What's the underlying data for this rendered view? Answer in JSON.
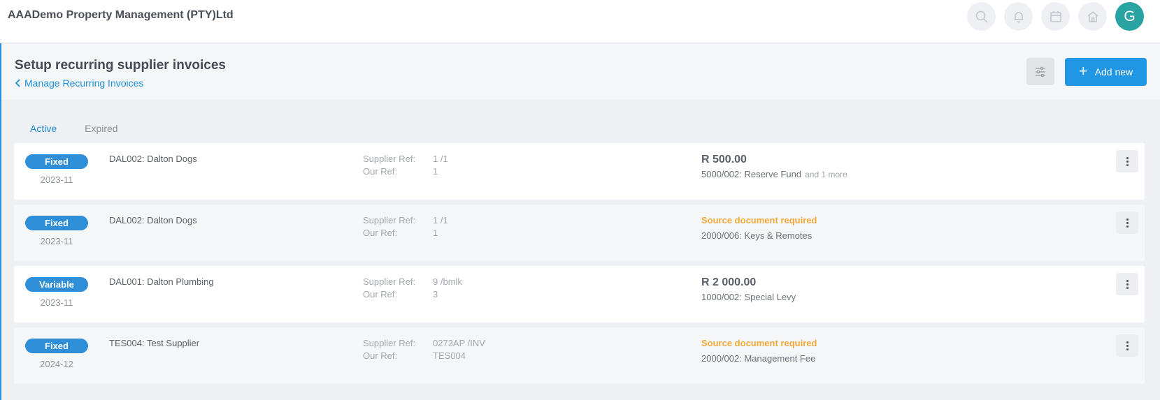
{
  "header": {
    "company": "AAADemo Property Management (PTY)Ltd",
    "avatar_letter": "G",
    "icons": [
      "search-icon",
      "bell-icon",
      "calendar-icon",
      "home-icon"
    ]
  },
  "page": {
    "title": "Setup recurring supplier invoices",
    "back_link": "Manage Recurring Invoices",
    "add_label": "Add new",
    "filter_icon": "sliders-icon"
  },
  "tabs": [
    {
      "label": "Active",
      "active": true
    },
    {
      "label": "Expired",
      "active": false
    }
  ],
  "labels": {
    "supplier_ref": "Supplier Ref:",
    "our_ref": "Our Ref:"
  },
  "invoices": [
    {
      "type": "Fixed",
      "period": "2023-11",
      "supplier": "DAL002: Dalton Dogs",
      "supplier_ref": "1 /1",
      "our_ref": "1",
      "amount": "R 500.00",
      "account": "5000/002: Reserve Fund",
      "more": "and 1 more"
    },
    {
      "type": "Fixed",
      "period": "2023-11",
      "supplier": "DAL002: Dalton Dogs",
      "supplier_ref": "1 /1",
      "our_ref": "1",
      "warning": "Source document required",
      "account": "2000/006: Keys & Remotes"
    },
    {
      "type": "Variable",
      "period": "2023-11",
      "supplier": "DAL001: Dalton Plumbing",
      "supplier_ref": "9 /bmlk",
      "our_ref": "3",
      "amount": "R 2 000.00",
      "account": "1000/002: Special Levy"
    },
    {
      "type": "Fixed",
      "period": "2024-12",
      "supplier": "TES004: Test Supplier",
      "supplier_ref": "0273AP /INV",
      "our_ref": "TES004",
      "warning": "Source document required",
      "account": "2000/002: Management Fee"
    }
  ],
  "colors": {
    "accent": "#2196e4",
    "badge": "#2e8fd8",
    "warning": "#f2a93b",
    "avatar": "#2aa3a3"
  }
}
